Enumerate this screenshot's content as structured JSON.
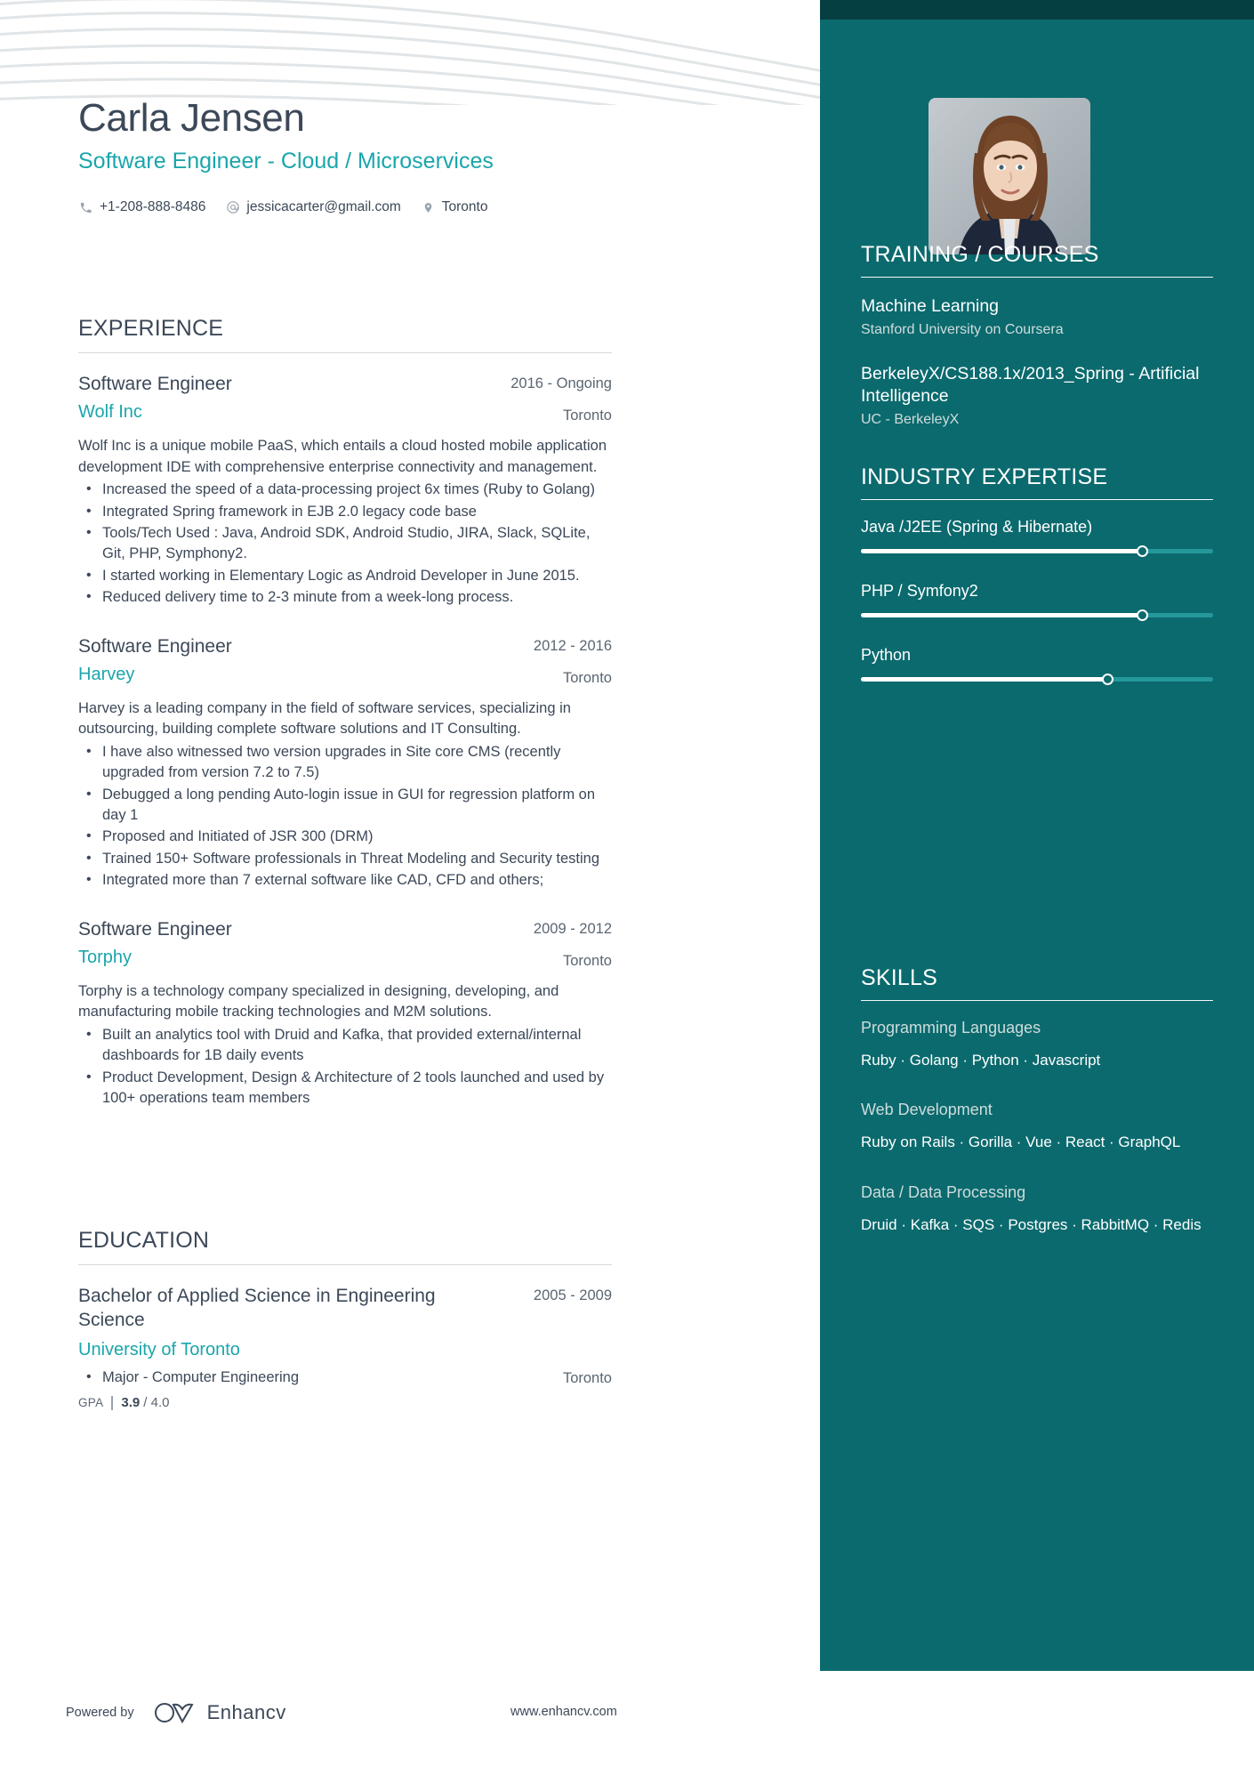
{
  "header": {
    "name": "Carla Jensen",
    "headline": "Software Engineer - Cloud / Microservices",
    "contacts": [
      {
        "icon": "phone-icon",
        "text": "+1-208-888-8486"
      },
      {
        "icon": "email-icon",
        "text": "jessicacarter@gmail.com"
      },
      {
        "icon": "location-pin-icon",
        "text": "Toronto"
      }
    ]
  },
  "experience": {
    "heading": "EXPERIENCE",
    "entries": [
      {
        "title": "Software Engineer",
        "organization": "Wolf Inc",
        "date": "2016 - Ongoing",
        "location": "Toronto",
        "description": "Wolf Inc is a unique mobile PaaS, which entails a cloud hosted mobile application development IDE with comprehensive enterprise connectivity and management.",
        "bullets": [
          "Increased the speed of a data-processing project 6x times (Ruby to Golang)",
          "Integrated Spring framework in EJB 2.0 legacy code base",
          "Tools/Tech Used : Java, Android SDK, Android Studio, JIRA, Slack, SQLite, Git, PHP, Symphony2.",
          "I started working in Elementary Logic as Android Developer in June 2015.",
          "Reduced delivery time to 2-3 minute from a week-long process."
        ]
      },
      {
        "title": "Software Engineer",
        "organization": "Harvey",
        "date": "2012 - 2016",
        "location": "Toronto",
        "description": "Harvey is a leading company in the field of software services, specializing in outsourcing, building complete software solutions and IT Consulting.",
        "bullets": [
          "I have also witnessed two version upgrades in Site core CMS (recently upgraded from version 7.2 to 7.5)",
          "Debugged a long pending Auto-login issue in GUI for regression platform on day 1",
          "Proposed and Initiated of JSR 300 (DRM)",
          "Trained 150+ Software professionals in Threat Modeling and Security testing",
          "Integrated more than 7 external software like CAD, CFD and others;"
        ]
      },
      {
        "title": "Software Engineer",
        "organization": "Torphy",
        "date": "2009 - 2012",
        "location": "Toronto",
        "description": "Torphy is a technology company specialized in designing, developing, and manufacturing mobile tracking technologies and M2M solutions.",
        "bullets": [
          "Built an analytics tool with Druid and Kafka, that provided external/internal dashboards for 1B daily events",
          "Product Development, Design & Architecture of 2 tools launched and used by 100+ operations team members"
        ]
      }
    ]
  },
  "education": {
    "heading": "EDUCATION",
    "entries": [
      {
        "title": "Bachelor of Applied Science in Engineering Science",
        "organization": "University of Toronto",
        "date": "2005 - 2009",
        "location": "Toronto",
        "bullets": [
          "Major - Computer Engineering"
        ],
        "gpa_label": "GPA",
        "gpa_value": "3.9",
        "gpa_max": "/ 4.0"
      }
    ]
  },
  "training": {
    "heading": "TRAINING / COURSES",
    "courses": [
      {
        "name": "Machine Learning",
        "provider": "Stanford University on Coursera"
      },
      {
        "name": "BerkeleyX/CS188.1x/2013_Spring - Artificial Intelligence",
        "provider": "UC - BerkeleyX"
      }
    ]
  },
  "industry_expertise": {
    "heading": "INDUSTRY EXPERTISE",
    "items": [
      {
        "label": "Java /J2EE (Spring & Hibernate)",
        "level": 80
      },
      {
        "label": "PHP / Symfony2",
        "level": 80
      },
      {
        "label": "Python",
        "level": 70
      }
    ]
  },
  "skills": {
    "heading": "SKILLS",
    "groups": [
      {
        "name": "Programming Languages",
        "items": "Ruby · Golang · Python · Javascript"
      },
      {
        "name": "Web Development",
        "items": "Ruby on Rails · Gorilla · Vue · React · GraphQL"
      },
      {
        "name": "Data / Data Processing",
        "items": "Druid · Kafka · SQS · Postgres · RabbitMQ · Redis"
      }
    ]
  },
  "footer": {
    "powered_by": "Powered by",
    "brand": "Enhancv",
    "website": "www.enhancv.com"
  },
  "colors": {
    "sidebar": "#0b6a6e",
    "sidebar_top_strip": "#053f41",
    "accent_teal": "#1aa6ac",
    "text": "#3c4858"
  }
}
